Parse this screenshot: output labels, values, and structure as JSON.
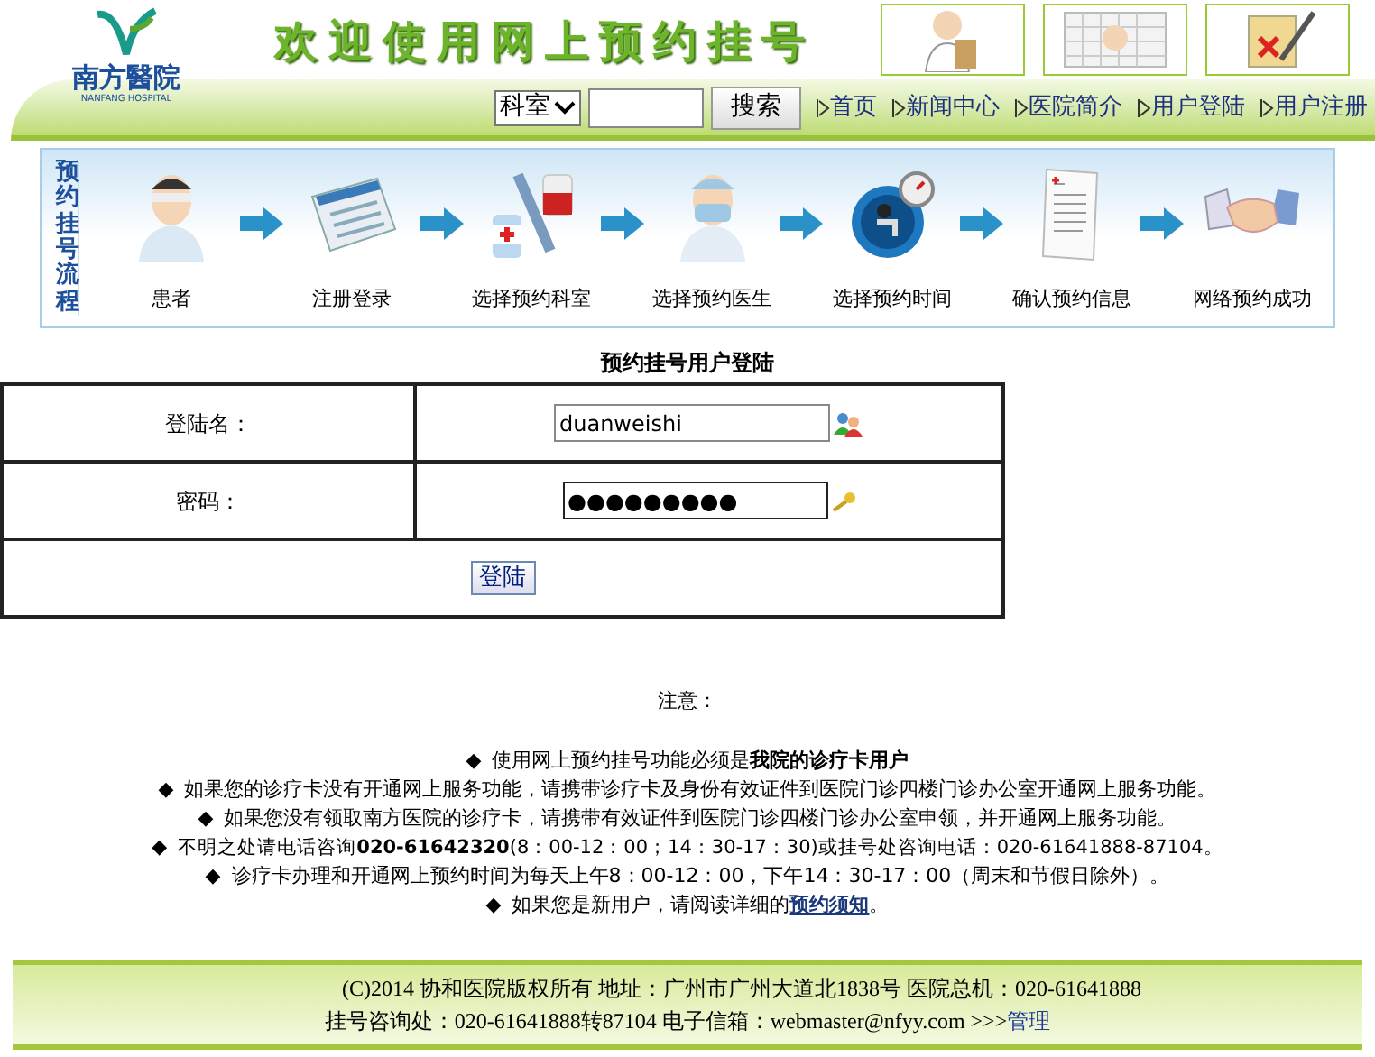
{
  "header": {
    "logo_text": "南方醫院",
    "logo_subtext": "NANFANG HOSPITAL",
    "banner_title": "欢迎使用网上预约挂号",
    "search": {
      "select_value": "科室",
      "button": "搜索"
    },
    "nav": [
      {
        "label": "首页"
      },
      {
        "label": "新闻中心"
      },
      {
        "label": "医院简介"
      },
      {
        "label": "用户登陆"
      },
      {
        "label": "用户注册"
      }
    ]
  },
  "process": {
    "label": "预约挂号流程",
    "steps": [
      {
        "label": "患者",
        "kind": "patient"
      },
      {
        "label": "注册登录",
        "kind": "form"
      },
      {
        "label": "选择预约科室",
        "kind": "medicine"
      },
      {
        "label": "选择预约医生",
        "kind": "doctor"
      },
      {
        "label": "选择预约时间",
        "kind": "clock"
      },
      {
        "label": "确认预约信息",
        "kind": "document"
      },
      {
        "label": "网络预约成功",
        "kind": "handshake"
      }
    ]
  },
  "login": {
    "title": "预约挂号用户登陆",
    "username_label": "登陆名：",
    "username_value": "duanweishi",
    "password_label": "密码：",
    "password_value": "●●●●●●●●●",
    "button": "登陆"
  },
  "notice": {
    "title": "注意：",
    "items": [
      {
        "bullet": "◆",
        "text": "使用网上预约挂号功能必须是**我院的诊疗卡用户**"
      },
      {
        "bullet": "◆",
        "text": "如果您的诊疗卡没有开通网上服务功能，请携带诊疗卡及身份有效证件到医院门诊四楼门诊办公室开通网上服务功能。"
      },
      {
        "bullet": "◆",
        "text": "如果您没有领取南方医院的诊疗卡，请携带有效证件到医院门诊四楼门诊办公室申领，并开通网上服务功能。"
      },
      {
        "bullet": "◆",
        "text": "不明之处请电话咨询**020-61642320**(8：00-12：00；14：30-17：30)或挂号处咨询电话：020-61641888-87104。"
      },
      {
        "bullet": "◆",
        "text": "诊疗卡办理和开通网上预约时间为每天上午8：00-12：00，下午14：30-17：00（周末和节假日除外）。"
      },
      {
        "bullet": "◆",
        "text": "如果您是新用户，请阅读详细的",
        "link": "预约须知",
        "after": "。"
      }
    ]
  },
  "footer": {
    "line_1": "(C)2014 协和医院版权所有 地址：广州市广州大道北1838号 医院总机：020-61641888",
    "line_2": "挂号咨询处：020-61641888转87104 电子信箱：webmaster@nfyy.com >>>",
    "link": "管理"
  }
}
